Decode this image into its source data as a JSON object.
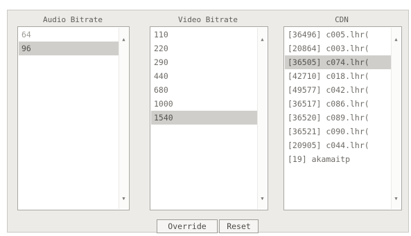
{
  "audio": {
    "title": "Audio Bitrate",
    "items": [
      {
        "label": "64",
        "state": "disabled"
      },
      {
        "label": "96",
        "state": "selected"
      }
    ]
  },
  "video": {
    "title": "Video Bitrate",
    "items": [
      {
        "label": "110",
        "state": "normal"
      },
      {
        "label": "220",
        "state": "normal"
      },
      {
        "label": "290",
        "state": "normal"
      },
      {
        "label": "440",
        "state": "normal"
      },
      {
        "label": "680",
        "state": "normal"
      },
      {
        "label": "1000",
        "state": "normal"
      },
      {
        "label": "1540",
        "state": "selected"
      }
    ]
  },
  "cdn": {
    "title": "CDN",
    "items": [
      {
        "label": "[36496] c005.lhr(",
        "state": "normal"
      },
      {
        "label": "[20864] c003.lhr(",
        "state": "normal"
      },
      {
        "label": "[36505] c074.lhr(",
        "state": "selected"
      },
      {
        "label": "[42710] c018.lhr(",
        "state": "normal"
      },
      {
        "label": "[49577] c042.lhr(",
        "state": "normal"
      },
      {
        "label": "[36517] c086.lhr(",
        "state": "normal"
      },
      {
        "label": "[36520] c089.lhr(",
        "state": "normal"
      },
      {
        "label": "[36521] c090.lhr(",
        "state": "normal"
      },
      {
        "label": "[20905] c044.lhr(",
        "state": "normal"
      },
      {
        "label": "[19] akamaitp",
        "state": "normal"
      }
    ]
  },
  "buttons": {
    "override": "Override",
    "reset": "Reset"
  },
  "icons": {
    "scroll_up": "scroll-up-arrow-icon",
    "scroll_down": "scroll-down-arrow-icon"
  }
}
